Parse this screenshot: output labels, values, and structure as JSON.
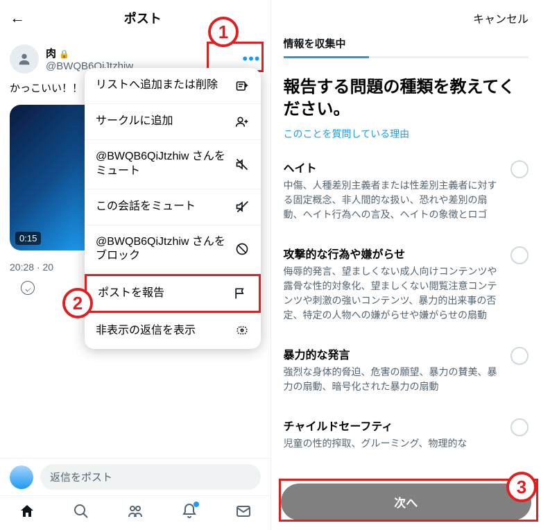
{
  "left": {
    "header_title": "ポスト",
    "user": {
      "name": "肉",
      "handle": "@BWQB6QiJtzhiw",
      "locked": true
    },
    "body_text": "かっこいい！！",
    "media_duration": "0:15",
    "timestamp": "20:28 · 20",
    "compose_placeholder": "返信をポスト",
    "menu": [
      {
        "label": "リストへ追加または削除",
        "icon": "list-add-icon"
      },
      {
        "label": "サークルに追加",
        "icon": "person-add-icon"
      },
      {
        "label": "@BWQB6QiJtzhiw さんをミュート",
        "icon": "mute-icon"
      },
      {
        "label": "この会話をミュート",
        "icon": "mute-convo-icon"
      },
      {
        "label": "@BWQB6QiJtzhiw さんをブロック",
        "icon": "block-icon"
      },
      {
        "label": "ポストを報告",
        "icon": "flag-icon"
      },
      {
        "label": "非表示の返信を表示",
        "icon": "hidden-replies-icon"
      }
    ]
  },
  "right": {
    "cancel": "キャンセル",
    "collecting": "情報を収集中",
    "question": "報告する問題の種類を教えてください。",
    "reason_link": "このことを質問している理由",
    "options": [
      {
        "title": "ヘイト",
        "desc": "中傷、人種差別主義者または性差別主義者に対する固定概念、非人間的な扱い、恐れや差別の扇動、ヘイト行為への言及、ヘイトの象徴とロゴ"
      },
      {
        "title": "攻撃的な行為や嫌がらせ",
        "desc": "侮辱的発言、望ましくない成人向けコンテンツや露骨な性的対象化、望ましくない閲覧注意コンテンツや刺激の強いコンテンツ、暴力的出来事の否定、特定の人物への嫌がらせや嫌がらせの扇動"
      },
      {
        "title": "暴力的な発言",
        "desc": "強烈な身体的脅迫、危害の願望、暴力の賛美、暴力の扇動、暗号化された暴力の扇動"
      },
      {
        "title": "チャイルドセーフティ",
        "desc": "児童の性的搾取、グルーミング、物理的な"
      }
    ],
    "next_button": "次へ"
  },
  "annotations": {
    "1": "1",
    "2": "2",
    "3": "3"
  },
  "colors": {
    "accent": "#1d9bf0",
    "highlight": "#e02020"
  }
}
